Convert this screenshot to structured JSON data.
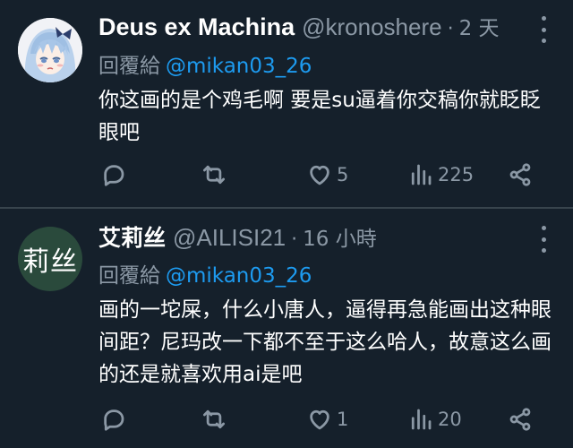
{
  "tweets": [
    {
      "display_name": "Deus ex Machina",
      "handle": "@kronoshere",
      "separator": "·",
      "time": "2 天",
      "reply_label": "回覆給",
      "reply_user": "@mikan03_26",
      "text": "你这画的是个鸡毛啊 要是su逼着你交稿你就眨眨眼吧",
      "replies": "",
      "retweets": "",
      "likes": "5",
      "views": "225",
      "avatar": "anime-girl-avatar"
    },
    {
      "display_name": "艾莉丝",
      "handle": "@AILISI21",
      "separator": "·",
      "time": "16 小時",
      "reply_label": "回覆給",
      "reply_user": "@mikan03_26",
      "text": "画的一坨屎，什么小唐人，逼得再急能画出这种眼间距？尼玛改一下都不至于这么哈人，故意这么画的还是就喜欢用ai是吧",
      "replies": "",
      "retweets": "",
      "likes": "1",
      "views": "20",
      "avatar_text": "莉丝",
      "avatar_color": "#2a4a3c"
    }
  ],
  "icons": {
    "reply": "reply-icon",
    "retweet": "retweet-icon",
    "like": "heart-icon",
    "views": "views-icon",
    "share": "share-icon",
    "more": "more-icon"
  },
  "colors": {
    "background": "#15202b",
    "text": "#ffffff",
    "muted": "#8b98a5",
    "link": "#1d9bf0",
    "divider": "#38444d"
  }
}
